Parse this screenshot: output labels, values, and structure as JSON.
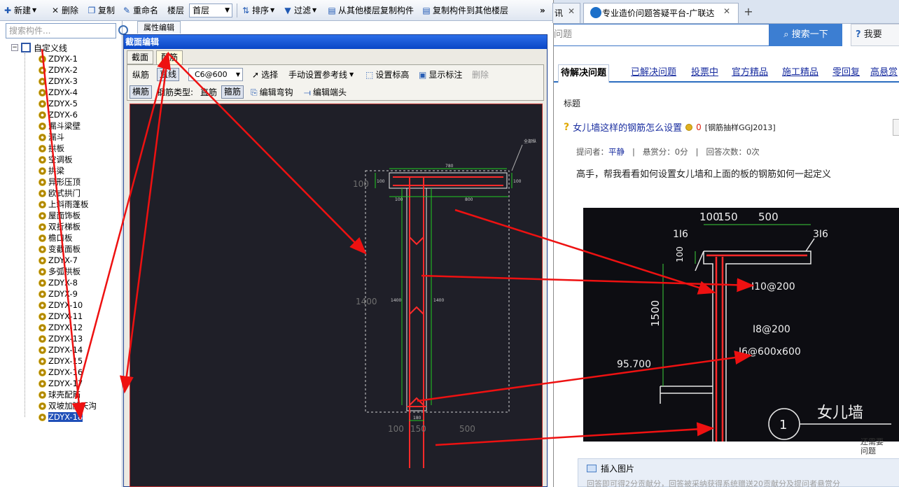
{
  "toolbar": {
    "new_label": "新建",
    "delete_label": "删除",
    "copy_label": "复制",
    "rename_label": "重命名",
    "floor_label": "楼层",
    "floor_value": "首层",
    "sort_label": "排序",
    "filter_label": "过滤",
    "copy_from_label": "从其他楼层复制构件",
    "copy_to_label": "复制构件到其他楼层",
    "more_label": "»"
  },
  "left_panel": {
    "search_placeholder": "搜索构件...",
    "property_tab": "属性编辑",
    "tree_root": "自定义线",
    "items": [
      "ZDYX-1",
      "ZDYX-2",
      "ZDYX-3",
      "ZDYX-4",
      "ZDYX-5",
      "ZDYX-6",
      "漏斗梁壁",
      "漏斗",
      "拱板",
      "空调板",
      "拱梁",
      "异形压顶",
      "欧式拱门",
      "上斜雨蓬板",
      "屋面饰板",
      "双折梯板",
      "檐口板",
      "变截面板",
      "ZDYX-7",
      "多弧拱板",
      "ZDYX-8",
      "ZDYX-9",
      "ZDYX-10",
      "ZDYX-11",
      "ZDYX-12",
      "ZDYX-13",
      "ZDYX-14",
      "ZDYX-15",
      "ZDYX-16",
      "ZDYX-17",
      "球壳配筋",
      "双坡加腋天沟",
      "ZDYX-18"
    ],
    "selected_item": "ZDYX-18"
  },
  "dialog": {
    "title": "截面编辑",
    "tabs": [
      "截面",
      "配筋"
    ],
    "row1": {
      "longitudinal": "纵筋",
      "line_mode": "直线",
      "spacing_value": "C6@600",
      "select_label": "选择",
      "ref_line_label": "手动设置参考线",
      "set_elev_label": "设置标高",
      "show_mark_label": "显示标注",
      "delete_label": "删除"
    },
    "row2": {
      "transverse": "横筋",
      "bar_type_label": "钢筋类型:",
      "straight_bar": "直筋",
      "stirrup": "箍筋",
      "edit_hook": "编辑弯钩",
      "edit_end": "编辑端头"
    },
    "canvas": {
      "label_top": "全部纵",
      "dim_780": "780",
      "dim_100_left": "100",
      "dim_100_right": "100",
      "dim_100_small": "100",
      "dim_800": "800",
      "dim_1400_big": "1400",
      "dim_1400_a": "1400",
      "dim_1400_b": "1400",
      "dim_180": "180",
      "bottom_100": "100",
      "bottom_150": "150",
      "bottom_500": "500"
    }
  },
  "browser": {
    "tab1_label": "讯",
    "tab2_label": "专业造价问题答疑平台-广联达",
    "new_tab": "+",
    "search_placeholder": "问题",
    "search_button": "搜索一下",
    "help_button": "我要",
    "nav_tabs": [
      "待解决问题",
      "已解决问题",
      "投票中",
      "官方精品",
      "施工精品",
      "零回复",
      "高悬赏"
    ],
    "title_label": "标题",
    "question_title": "女儿墙这样的钢筋怎么设置",
    "question_reward": "0",
    "question_tag": "[钢筋抽样GGJ2013]",
    "meta_asker_label": "提问者：",
    "meta_asker": "平静",
    "meta_reward": "悬赏分：0分",
    "meta_answers": "回答次数：0次",
    "meta_sep": "|",
    "question_body": "高手，帮我看看如何设置女儿墙和上面的板的钢筋如何一起定义",
    "cad": {
      "dim_100": "100",
      "dim_150": "150",
      "dim_500": "500",
      "rebar_1i6": "1I6",
      "rebar_3i6": "3I6",
      "dim_100_v": "100",
      "rebar_i10": "I10@200",
      "dim_1500": "1500",
      "rebar_i8": "I8@200",
      "rebar_i6": "I6@600x600",
      "elevation": "95.700",
      "circle_num": "1",
      "wall_label": "女儿墙"
    },
    "insert_image": "插入图片",
    "insert_hint": "回答即可得2分贡献分，回答被采纳获得系统赠送20贡献分及提问者悬赏分",
    "side_hint_1": "还需要",
    "side_hint_2": "问题"
  }
}
